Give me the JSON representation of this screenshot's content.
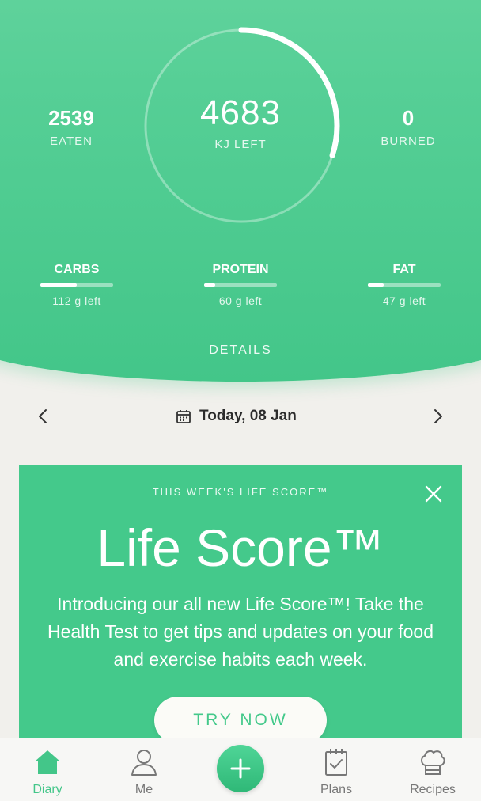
{
  "summary": {
    "eaten_value": "2539",
    "eaten_label": "EATEN",
    "remaining_value": "4683",
    "remaining_label": "KJ LEFT",
    "burned_value": "0",
    "burned_label": "BURNED",
    "ring_progress": 0.3
  },
  "macros": [
    {
      "name": "CARBS",
      "left": "112 g left",
      "progress": 0.5
    },
    {
      "name": "PROTEIN",
      "left": "60 g left",
      "progress": 0.15
    },
    {
      "name": "FAT",
      "left": "47 g left",
      "progress": 0.22
    }
  ],
  "details_label": "DETAILS",
  "date": {
    "label": "Today, 08 Jan",
    "prev_icon": "chevron-left-icon",
    "next_icon": "chevron-right-icon",
    "calendar_icon": "calendar-icon"
  },
  "card": {
    "eyebrow": "THIS WEEK'S LIFE SCORE™",
    "title": "Life Score™",
    "body": "Introducing our all new Life Score™! Take the Health Test to get tips and updates on your food and exercise habits each week.",
    "button_label": "TRY NOW",
    "close_icon": "close-icon",
    "background": "#44c98b"
  },
  "nav": {
    "items": [
      {
        "label": "Diary",
        "icon": "home-icon",
        "active": true
      },
      {
        "label": "Me",
        "icon": "person-icon",
        "active": false
      },
      {
        "label": "Plans",
        "icon": "clipboard-check-icon",
        "active": false
      },
      {
        "label": "Recipes",
        "icon": "chef-hat-icon",
        "active": false
      }
    ],
    "add_icon": "plus-icon"
  },
  "colors": {
    "accent": "#43c689",
    "header_top": "#6fd7a5",
    "background": "#f1f0ec"
  }
}
